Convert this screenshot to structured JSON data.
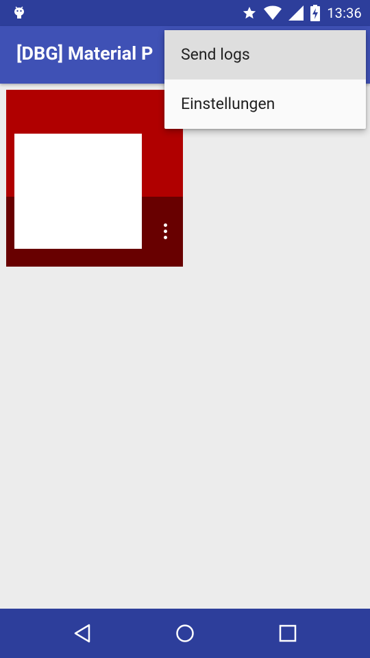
{
  "status_bar": {
    "time": "13:36",
    "icons": [
      "android-debug-icon",
      "star-icon",
      "wifi-icon",
      "signal-icon",
      "battery-charging-icon"
    ]
  },
  "app_bar": {
    "title": "[DBG] Material P"
  },
  "menu": {
    "items": [
      {
        "label": "Send logs"
      },
      {
        "label": "Einstellungen"
      }
    ]
  },
  "card": {
    "menu_icon": "more-vert-icon"
  },
  "nav_bar": {
    "icons": [
      "back-icon",
      "home-icon",
      "recents-icon"
    ]
  },
  "colors": {
    "status_bar": "#2d3e9b",
    "app_bar": "#3f51b5",
    "card_top": "#b00000",
    "card_bottom": "#680000",
    "background": "#ececec"
  }
}
